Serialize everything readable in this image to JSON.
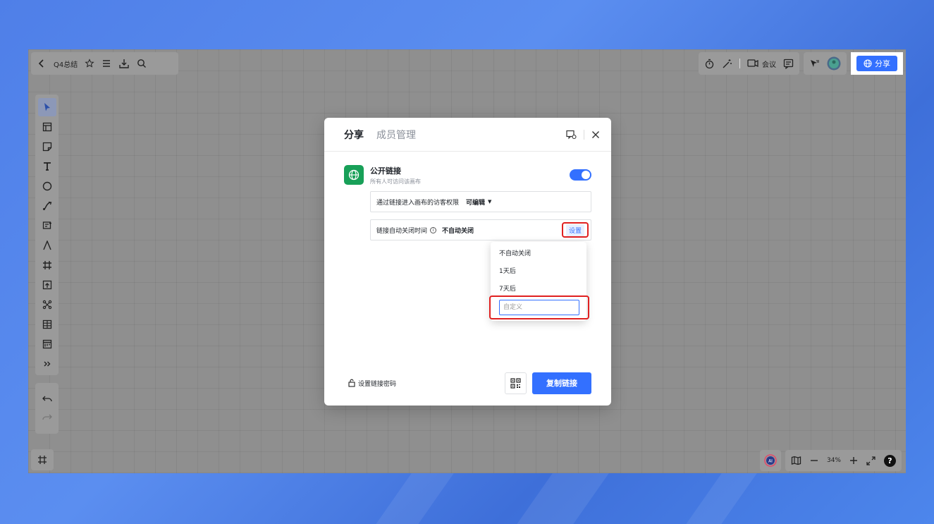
{
  "topbar": {
    "doc_title": "Q4总结",
    "meeting_label": "会议",
    "share_label": "分享"
  },
  "bottom": {
    "zoom": "34%",
    "help": "?",
    "ai_badge": "AI"
  },
  "modal": {
    "tabs": [
      {
        "label": "分享"
      },
      {
        "label": "成员管理"
      }
    ],
    "public_link": {
      "title": "公开链接",
      "subtitle": "所有人可访问该画布",
      "enabled": true
    },
    "permission": {
      "label": "通过链接进入画布的访客权限",
      "value": "可编辑"
    },
    "expire": {
      "label": "链接自动关闭时间",
      "value": "不自动关闭",
      "set_label": "设置"
    },
    "dropdown": {
      "options": [
        "不自动关闭",
        "1天后",
        "7天后"
      ],
      "custom_placeholder": "自定义"
    },
    "footer": {
      "password_label": "设置链接密码",
      "copy_label": "复制链接"
    }
  },
  "colors": {
    "accent": "#3370ff",
    "highlight": "#e02020",
    "public_icon_bg": "#18a058"
  }
}
